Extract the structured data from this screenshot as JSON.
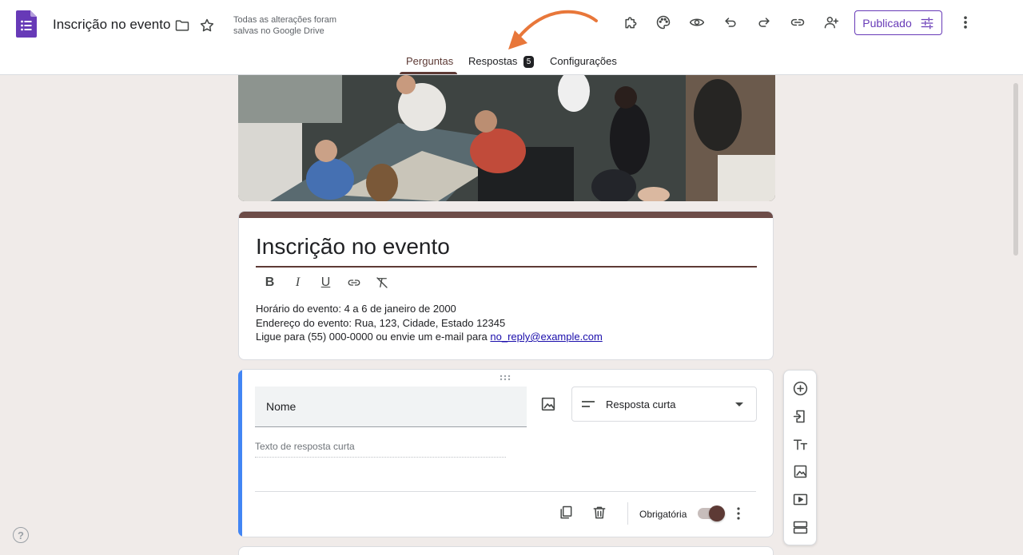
{
  "app": {
    "doc_title": "Inscrição no evento",
    "save_status": "Todas as alterações foram salvas no Google Drive",
    "publish_label": "Publicado",
    "accent_color": "#673ab7",
    "theme_color": "#5d3a35"
  },
  "header_icons": [
    "folder-icon",
    "star-icon",
    "addons-icon",
    "palette-icon",
    "preview-icon",
    "undo-icon",
    "redo-icon",
    "link-icon",
    "add-collaborator-icon",
    "more-icon"
  ],
  "tabs": [
    {
      "label": "Perguntas",
      "active": true
    },
    {
      "label": "Respostas",
      "badge": "5"
    },
    {
      "label": "Configurações"
    }
  ],
  "form": {
    "title": "Inscrição no evento",
    "description_lines": [
      "Horário do evento: 4 a 6 de janeiro de 2000",
      "Endereço do evento: Rua, 123, Cidade, Estado 12345",
      "Ligue para (55) 000-0000 ou envie um e-mail para "
    ],
    "description_email": "no_reply@example.com",
    "format_tools": [
      "bold-icon",
      "italic-icon",
      "underline-icon",
      "link-icon",
      "clear-format-icon"
    ]
  },
  "question": {
    "title": "Nome",
    "type": "Resposta curta",
    "answer_placeholder": "Texto de resposta curta",
    "required_label": "Obrigatória",
    "required": true
  },
  "side_toolbar": [
    "add-question-icon",
    "import-questions-icon",
    "add-title-icon",
    "add-image-icon",
    "add-video-icon",
    "add-section-icon"
  ]
}
